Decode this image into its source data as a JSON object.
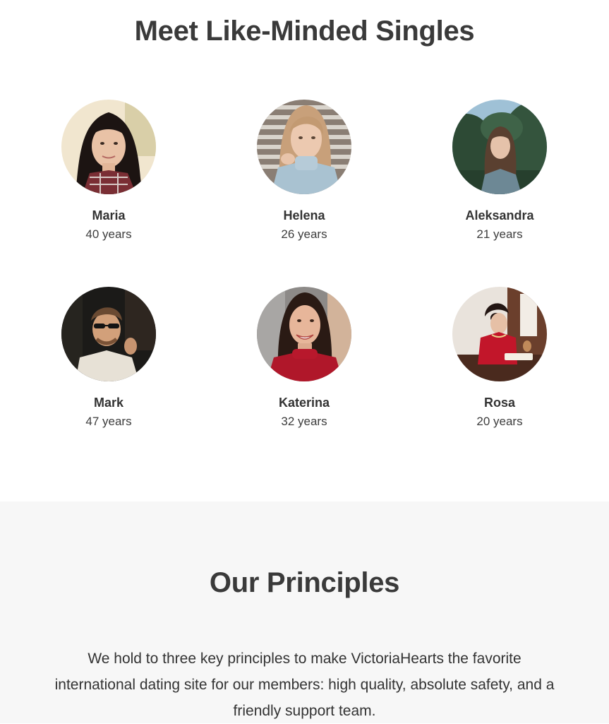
{
  "singles": {
    "title": "Meet Like-Minded Singles",
    "profiles": [
      {
        "name": "Maria",
        "age": "40 years",
        "photo": "woman-dark-hair-plaid-shirt"
      },
      {
        "name": "Helena",
        "age": "26 years",
        "photo": "woman-blonde-turtleneck"
      },
      {
        "name": "Aleksandra",
        "age": "21 years",
        "photo": "woman-outdoors-trees"
      },
      {
        "name": "Mark",
        "age": "47 years",
        "photo": "man-sunglasses-white-tee"
      },
      {
        "name": "Katerina",
        "age": "32 years",
        "photo": "woman-smiling-red-top"
      },
      {
        "name": "Rosa",
        "age": "20 years",
        "photo": "woman-red-dress-cafe"
      }
    ]
  },
  "principles": {
    "title": "Our Principles",
    "text": "We hold to three key principles to make VictoriaHearts the favorite international dating site for our members: high quality, absolute safety, and a friendly support team."
  },
  "colors": {
    "heading": "#3a3a3a",
    "text": "#333333",
    "principles_background": "#f7f7f7"
  }
}
